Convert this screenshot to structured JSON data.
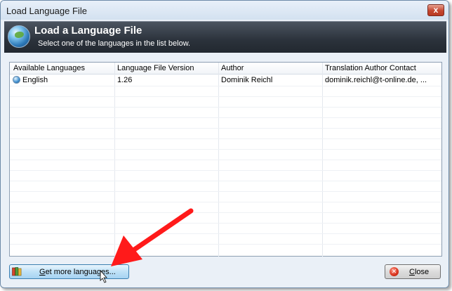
{
  "window": {
    "title": "Load Language File",
    "close_glyph": "x"
  },
  "banner": {
    "title": "Load a Language File",
    "subtitle": "Select one of the languages in the list below.",
    "icon": "globe-icon"
  },
  "list": {
    "columns": [
      "Available Languages",
      "Language File Version",
      "Author",
      "Translation Author Contact"
    ],
    "rows": [
      {
        "language": "English",
        "version": "1.26",
        "author": "Dominik Reichl",
        "contact": "dominik.reichl@t-online.de, ..."
      }
    ]
  },
  "buttons": {
    "more_prefix": "G",
    "more_rest": "et more languages...",
    "close_prefix": "C",
    "close_rest": "lose"
  },
  "colors": {
    "banner": "#2b323b",
    "arrow": "#ff1a1a",
    "accent_button": "#bfe1f7"
  }
}
